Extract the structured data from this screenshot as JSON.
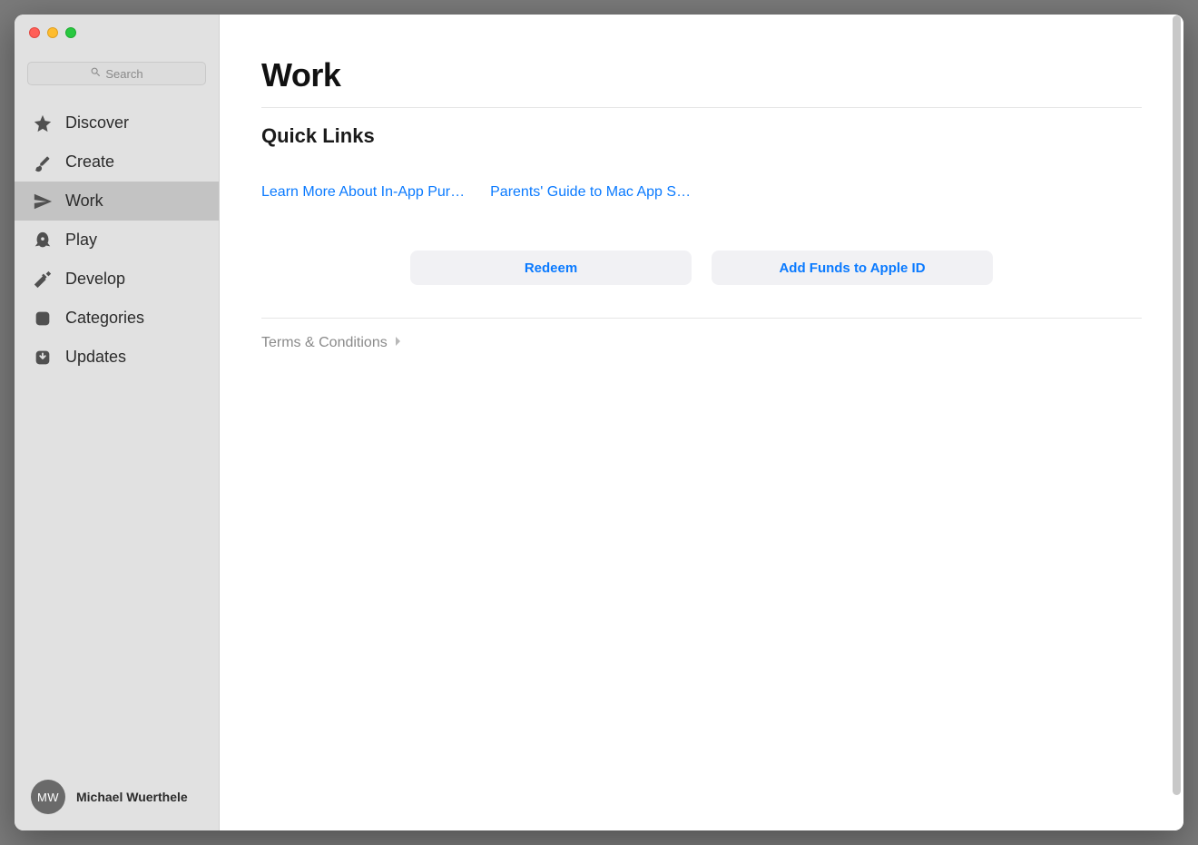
{
  "search": {
    "placeholder": "Search"
  },
  "sidebar": {
    "items": [
      {
        "label": "Discover"
      },
      {
        "label": "Create"
      },
      {
        "label": "Work"
      },
      {
        "label": "Play"
      },
      {
        "label": "Develop"
      },
      {
        "label": "Categories"
      },
      {
        "label": "Updates"
      }
    ]
  },
  "user": {
    "initials": "MW",
    "name": "Michael Wuerthele"
  },
  "main": {
    "title": "Work",
    "quick_links_title": "Quick Links",
    "links": [
      "Learn More About In-App Pur…",
      "Parents' Guide to Mac App St…"
    ],
    "buttons": {
      "redeem": "Redeem",
      "add_funds": "Add Funds to Apple ID"
    },
    "terms": "Terms & Conditions"
  }
}
